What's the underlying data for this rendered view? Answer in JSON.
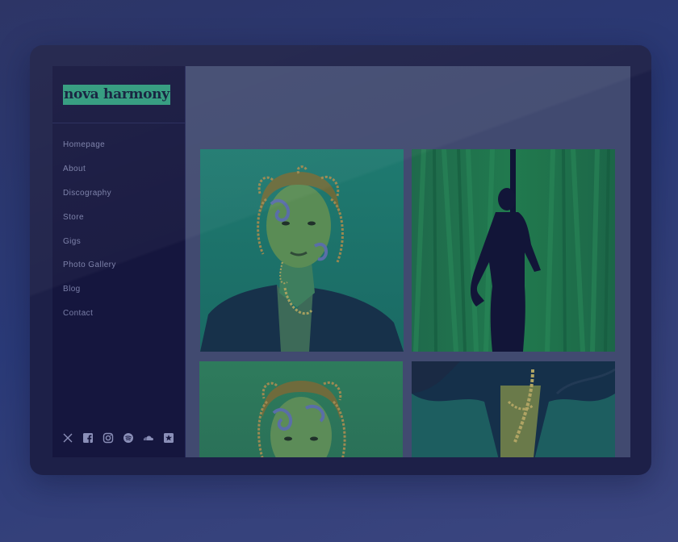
{
  "site": {
    "name": "nova harmony",
    "accent": "#2f9a7c"
  },
  "nav": {
    "items": [
      {
        "label": "Homepage"
      },
      {
        "label": "About"
      },
      {
        "label": "Discography"
      },
      {
        "label": "Store"
      },
      {
        "label": "Gigs"
      },
      {
        "label": "Photo Gallery"
      },
      {
        "label": "Blog"
      },
      {
        "label": "Contact"
      }
    ]
  },
  "socials": [
    "x-icon",
    "facebook-icon",
    "instagram-icon",
    "spotify-icon",
    "soundcloud-icon",
    "bandsintown-icon"
  ],
  "gallery": {
    "photos": [
      {
        "name": "portrait-braids-leather-jacket",
        "tone": "#1f6f6a"
      },
      {
        "name": "silhouette-green-curtains",
        "tone": "#1e6a4a"
      },
      {
        "name": "portrait-braids-closeup",
        "tone": "#2e7b5a"
      },
      {
        "name": "leather-jacket-chain-detail",
        "tone": "#1e5f62"
      }
    ]
  },
  "colors": {
    "background": "#2d3566",
    "sidebar": "#15163e",
    "content": "#414a70",
    "nav_text": "#7a7fa8"
  }
}
